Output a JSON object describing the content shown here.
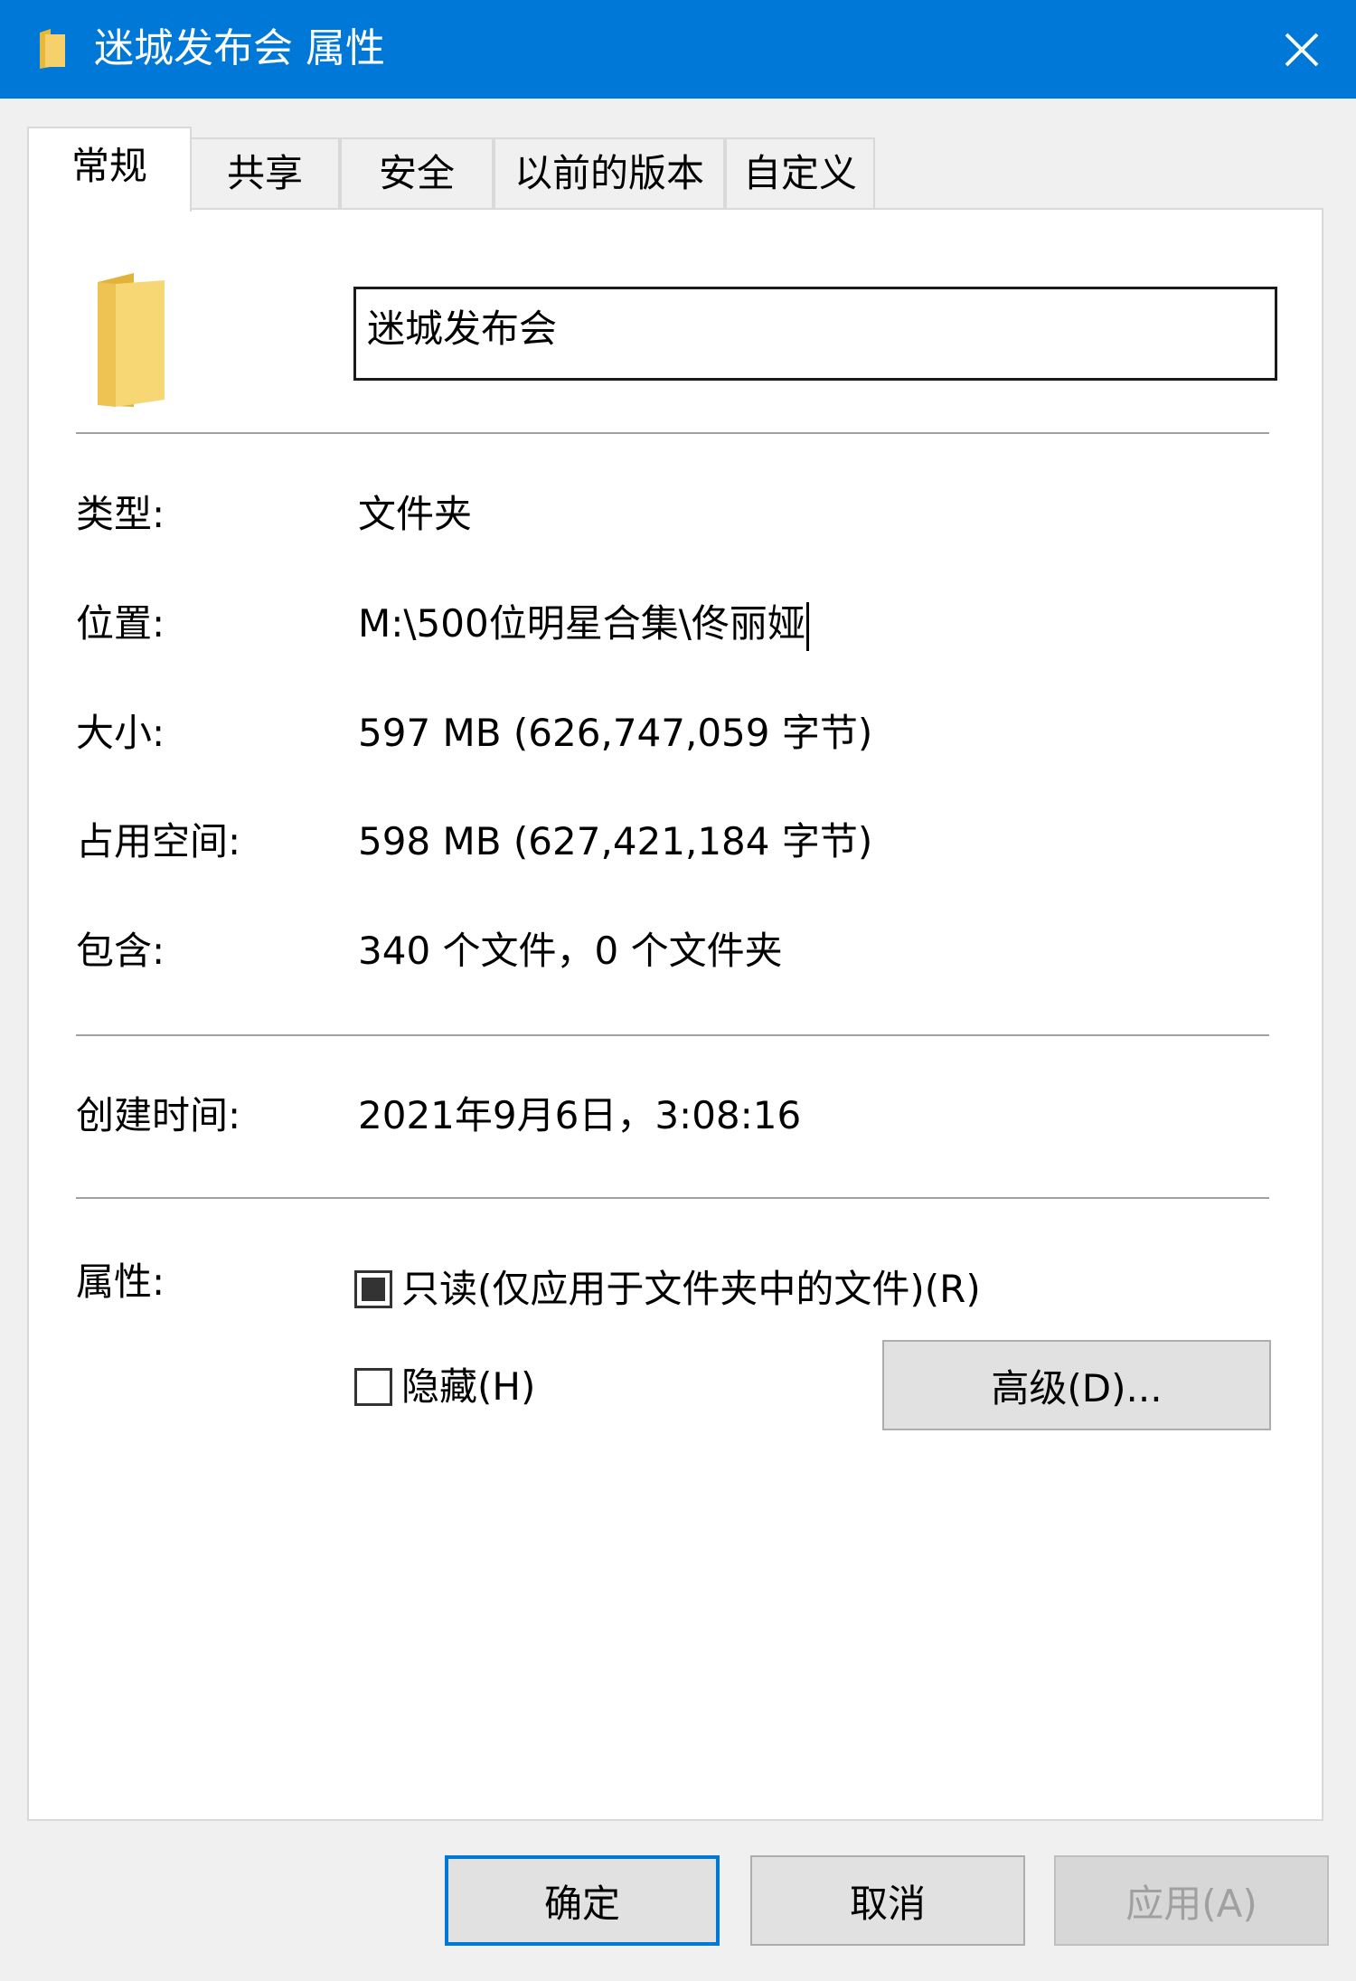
{
  "window": {
    "title": "迷城发布会 属性",
    "title_icon": "folder-icon",
    "close_icon": "close-icon"
  },
  "tabs": [
    {
      "label": "常规",
      "active": true
    },
    {
      "label": "共享",
      "active": false
    },
    {
      "label": "安全",
      "active": false
    },
    {
      "label": "以前的版本",
      "active": false
    },
    {
      "label": "自定义",
      "active": false
    }
  ],
  "general": {
    "folder_name": "迷城发布会",
    "rows": {
      "type": {
        "label": "类型:",
        "value": "文件夹"
      },
      "location": {
        "label": "位置:",
        "value": "M:\\500位明星合集\\佟丽娅"
      },
      "size": {
        "label": "大小:",
        "value": "597 MB (626,747,059 字节)"
      },
      "size_on_disk": {
        "label": "占用空间:",
        "value": "598 MB (627,421,184 字节)"
      },
      "contains": {
        "label": "包含:",
        "value": "340 个文件，0 个文件夹"
      },
      "created": {
        "label": "创建时间:",
        "value": "2021年9月6日，3:08:16"
      }
    },
    "attributes": {
      "label": "属性:",
      "readonly": {
        "label": "只读(仅应用于文件夹中的文件)(R)",
        "state": "indeterminate"
      },
      "hidden": {
        "label": "隐藏(H)",
        "state": "unchecked"
      },
      "advanced_button": "高级(D)..."
    }
  },
  "buttons": {
    "ok": "确定",
    "cancel": "取消",
    "apply": "应用(A)"
  },
  "colors": {
    "titlebar": "#0078d7",
    "folder": "#f2c94c",
    "panel": "#ffffff",
    "background": "#f0f0f0"
  }
}
